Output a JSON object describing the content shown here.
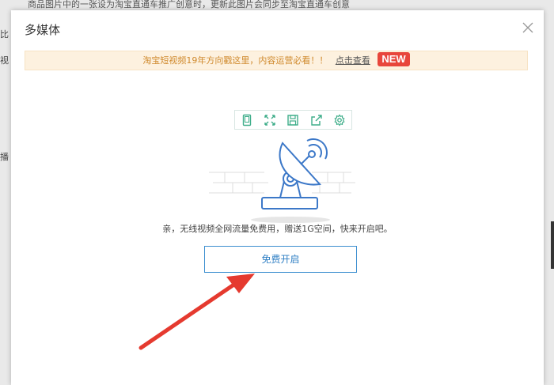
{
  "background": {
    "top_text": "商品图片中的一张设为淘宝直通车推广创意时，更新此图片会同步至淘宝直通车创意",
    "left_fragments": [
      "比",
      "视",
      "播"
    ]
  },
  "dialog": {
    "title": "多媒体",
    "close_icon": "close-icon",
    "notice": {
      "text": "淘宝短视频19年方向戳这里，内容运营必看！！",
      "link": "点击查看",
      "badge": "NEW"
    },
    "toolbar": {
      "icons": [
        "tablet-icon",
        "fullscreen-icon",
        "save-icon",
        "share-icon",
        "settings-icon"
      ]
    },
    "illustration": "satellite-dish-icon",
    "promo_text": "亲，无线视频全网流量免费用，赠送1G空间，快来开启吧。",
    "cta_label": "免费开启"
  },
  "colors": {
    "accent": "#3c8fd0",
    "notice_bg": "#fdf1df",
    "notice_text": "#d08a2e",
    "badge": "#e8463b",
    "toolbar_icon": "#3fae8a",
    "annotation_arrow": "#e53a2f"
  }
}
